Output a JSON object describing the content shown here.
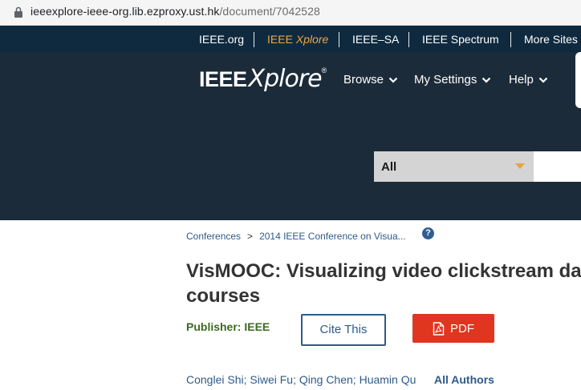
{
  "browser": {
    "url_host": "ieeexplore-ieee-org.lib.ezproxy.ust.hk",
    "url_path": "/document/7042528"
  },
  "topnav": {
    "links": [
      "IEEE.org",
      "IEEE",
      "Xplore",
      "IEEE–SA",
      "IEEE Spectrum",
      "More Sites"
    ]
  },
  "header": {
    "logo_ieee": "IEEE",
    "logo_xplore": "Xplore",
    "logo_reg": "®",
    "menu": [
      "Browse",
      "My Settings",
      "Help"
    ],
    "search_scope": "All",
    "search_placeholder": ""
  },
  "breadcrumb": {
    "items": [
      "Conferences",
      ">",
      "2014 IEEE Conference on Visua..."
    ],
    "help": "?"
  },
  "article": {
    "title_line1": "VisMOOC: Visualizing video clickstream da",
    "title_line2": "courses",
    "publisher": "Publisher: IEEE",
    "cite_label": "Cite This",
    "pdf_label": "PDF",
    "authors": [
      "Conglei Shi",
      "Siwei Fu",
      "Qing Chen",
      "Huamin Qu"
    ],
    "author_sep": ";",
    "all_authors": "All Authors"
  },
  "colors": {
    "topnav_bg": "#0f2a3e",
    "header_bg": "#1c2b3a",
    "accent_orange": "#f0a54a",
    "link_blue": "#2d5b8a",
    "pdf_red": "#e0351e",
    "publisher_green": "#3a6a20"
  }
}
